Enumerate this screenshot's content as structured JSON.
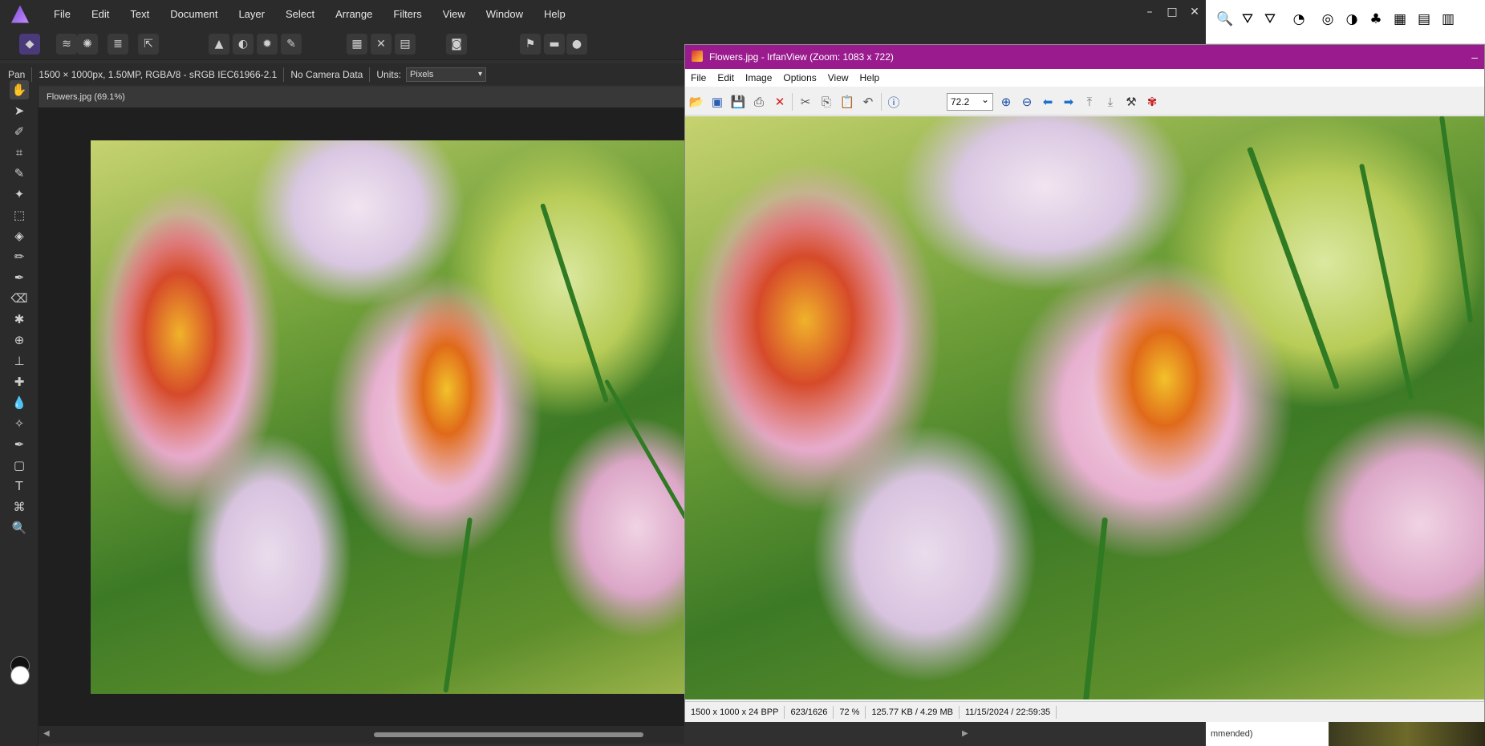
{
  "affinity": {
    "menu": [
      "File",
      "Edit",
      "Text",
      "Document",
      "Layer",
      "Select",
      "Arrange",
      "Filters",
      "View",
      "Window",
      "Help"
    ],
    "window_controls": [
      "–",
      "□",
      "✕"
    ],
    "context": {
      "tool": "Pan",
      "image_info": "1500 × 1000px, 1.50MP, RGBA/8 - sRGB IEC61966-2.1",
      "camera": "No Camera Data",
      "units_label": "Units:",
      "units_value": "Pixels"
    },
    "document_tab": "Flowers.jpg (69.1%)",
    "colors": {
      "accent": "#7b4dd6",
      "background": "#303030"
    }
  },
  "irfanview": {
    "title": "Flowers.jpg - IrfanView (Zoom: 1083 x 722)",
    "minimize": "–",
    "menu": [
      "File",
      "Edit",
      "Image",
      "Options",
      "View",
      "Help"
    ],
    "zoom_value": "72.2",
    "status": {
      "dimensions": "1500 x 1000 x 24 BPP",
      "position": "623/1626",
      "zoom": "72 %",
      "size": "125.77 KB / 4.29 MB",
      "datetime": "11/15/2024 / 22:59:35"
    },
    "colors": {
      "titlebar": "#9a1b8e"
    }
  },
  "desktop": {
    "bottom_text": "mmended)"
  }
}
